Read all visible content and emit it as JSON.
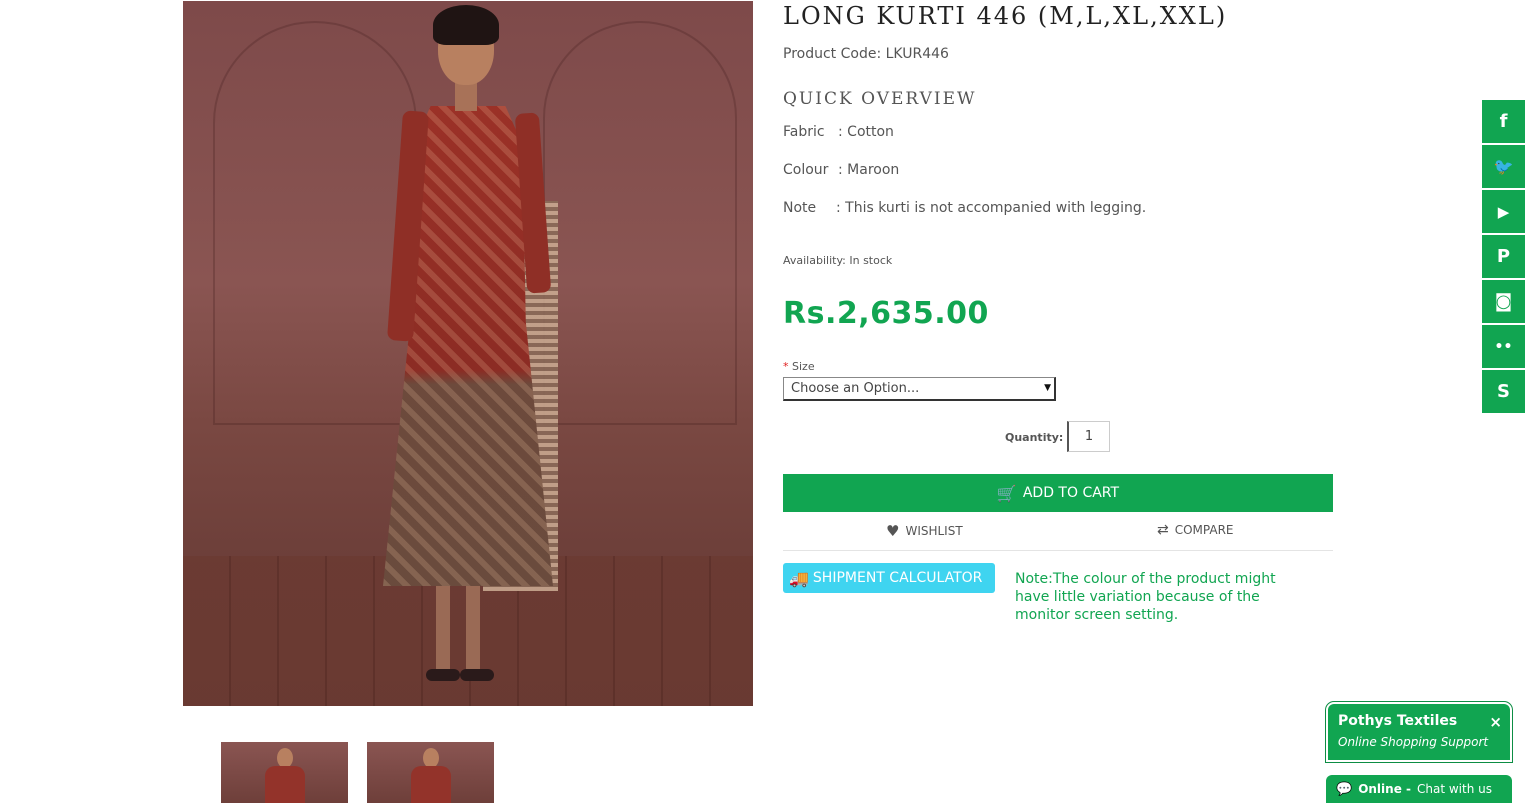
{
  "product": {
    "title": "LONG KURTI 446 (M,L,XL,XXL)",
    "code_line": "Product Code: LKUR446"
  },
  "overview": {
    "heading": "QUICK OVERVIEW",
    "specs": [
      {
        "label": "Fabric",
        "sep": ": Cotton"
      },
      {
        "label": "Colour",
        "sep": ": Maroon"
      },
      {
        "label": "Note",
        "sep": ": This kurti is not accompanied with legging."
      }
    ]
  },
  "availability": "Availability: In stock",
  "price": "Rs.2,635.00",
  "size": {
    "required_mark": "*",
    "label": "Size",
    "selected": "Choose an Option..."
  },
  "quantity": {
    "label": "Quantity:",
    "value": "1"
  },
  "actions": {
    "add_to_cart": "ADD TO CART",
    "wishlist": "WISHLIST",
    "compare": "COMPARE",
    "shipment": "SHIPMENT CALCULATOR"
  },
  "note": "Note:The colour of the product might have little variation because of the monitor screen setting.",
  "social": [
    {
      "icon": "facebook-icon",
      "glyph": "f"
    },
    {
      "icon": "twitter-icon",
      "glyph": "🐦"
    },
    {
      "icon": "youtube-icon",
      "glyph": "▶"
    },
    {
      "icon": "pinterest-icon",
      "glyph": "P"
    },
    {
      "icon": "instagram-icon",
      "glyph": "◙"
    },
    {
      "icon": "flickr-icon",
      "glyph": "••"
    },
    {
      "icon": "skype-icon",
      "glyph": "S"
    }
  ],
  "chat": {
    "title": "Pothys Textiles",
    "subtitle": "Online Shopping Support",
    "close": "×",
    "status": "Online -",
    "cta": "Chat with us"
  },
  "colors": {
    "brand_green": "#11a551",
    "ship_blue": "#3fd4f0"
  }
}
